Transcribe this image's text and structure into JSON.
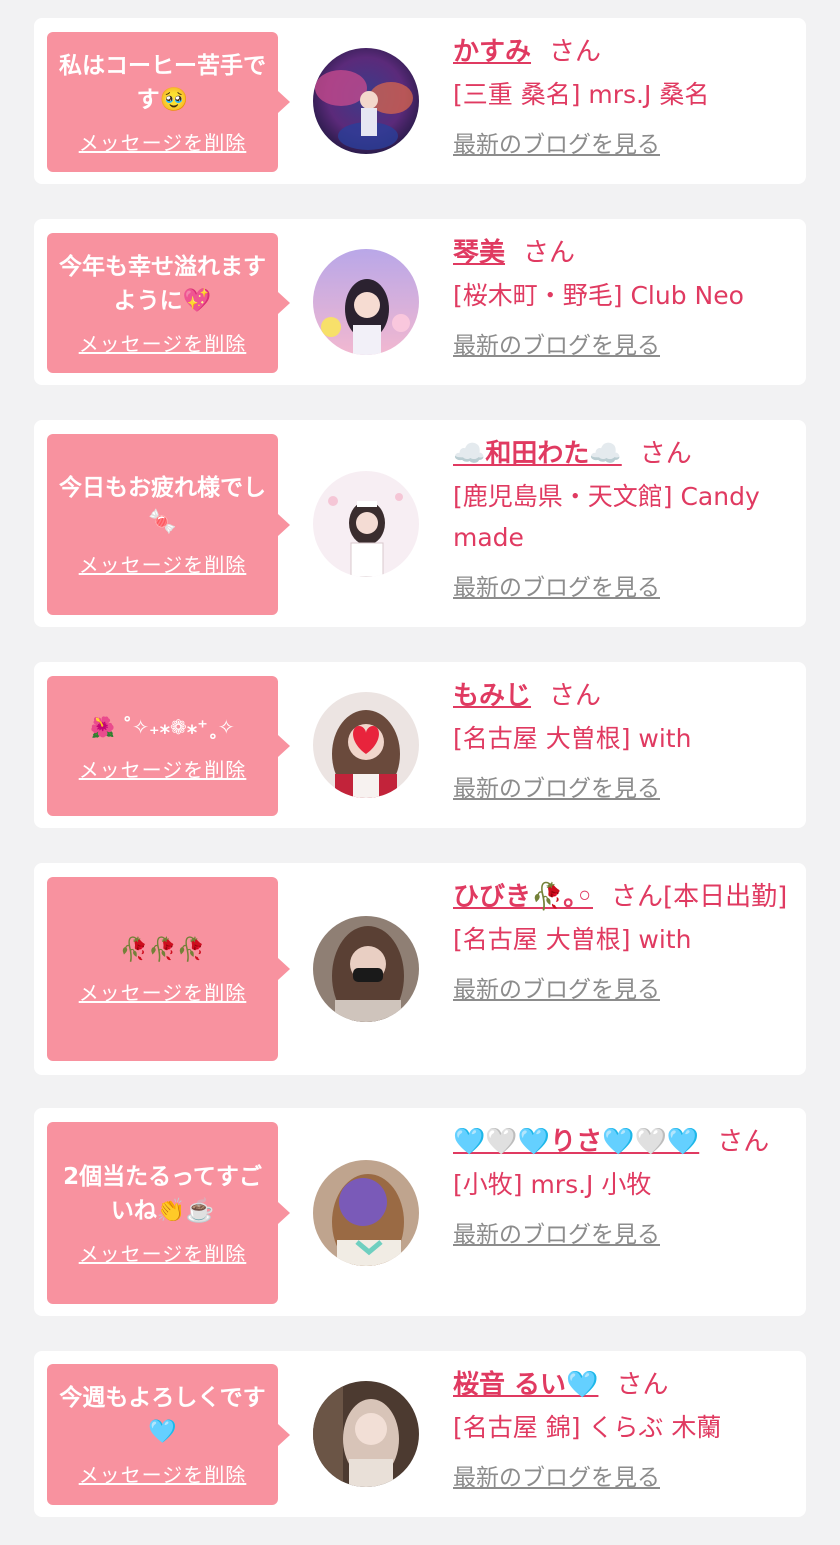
{
  "labels": {
    "delete": "メッセージを削除",
    "latest_blog": "最新のブログを見る",
    "honorific": "さん"
  },
  "accent_colors": {
    "bubble": "#f8929f",
    "name": "#e03a61",
    "link_gray": "#8c8c8c"
  },
  "messages": [
    {
      "message": "私はコーヒー苦手です🥹",
      "name": "かすみ",
      "suffix": "さん",
      "shop": "[三重 桑名] mrs.J 桑名"
    },
    {
      "message": "今年も幸せ溢れますように💖",
      "name": "琴美",
      "suffix": "さん",
      "shop": "[桜木町・野毛] Club Neo"
    },
    {
      "message": "今日もお疲れ様でし🍬",
      "name": "☁️和田わた☁️",
      "suffix": "さん",
      "shop": "[鹿児島県・天文館] Candy made"
    },
    {
      "message": "🌺 ˚✧₊⁎❁⁎⁺˳✧",
      "name": "もみじ",
      "suffix": "さん",
      "shop": "[名古屋 大曽根] with"
    },
    {
      "message": "🥀🥀🥀",
      "name": "ひびき🥀｡◦",
      "suffix": "さん[本日出勤]",
      "shop": "[名古屋 大曽根] with"
    },
    {
      "message": "2個当たるってすごいね👏☕️",
      "name": "🩵🤍🩵りさ🩵🤍🩵",
      "suffix": "さん",
      "shop": "[小牧] mrs.J 小牧"
    },
    {
      "message": "今週もよろしくです🩵",
      "name": "桜音 るい🩵",
      "suffix": "さん",
      "shop": "[名古屋 錦] くらぶ 木蘭"
    }
  ]
}
